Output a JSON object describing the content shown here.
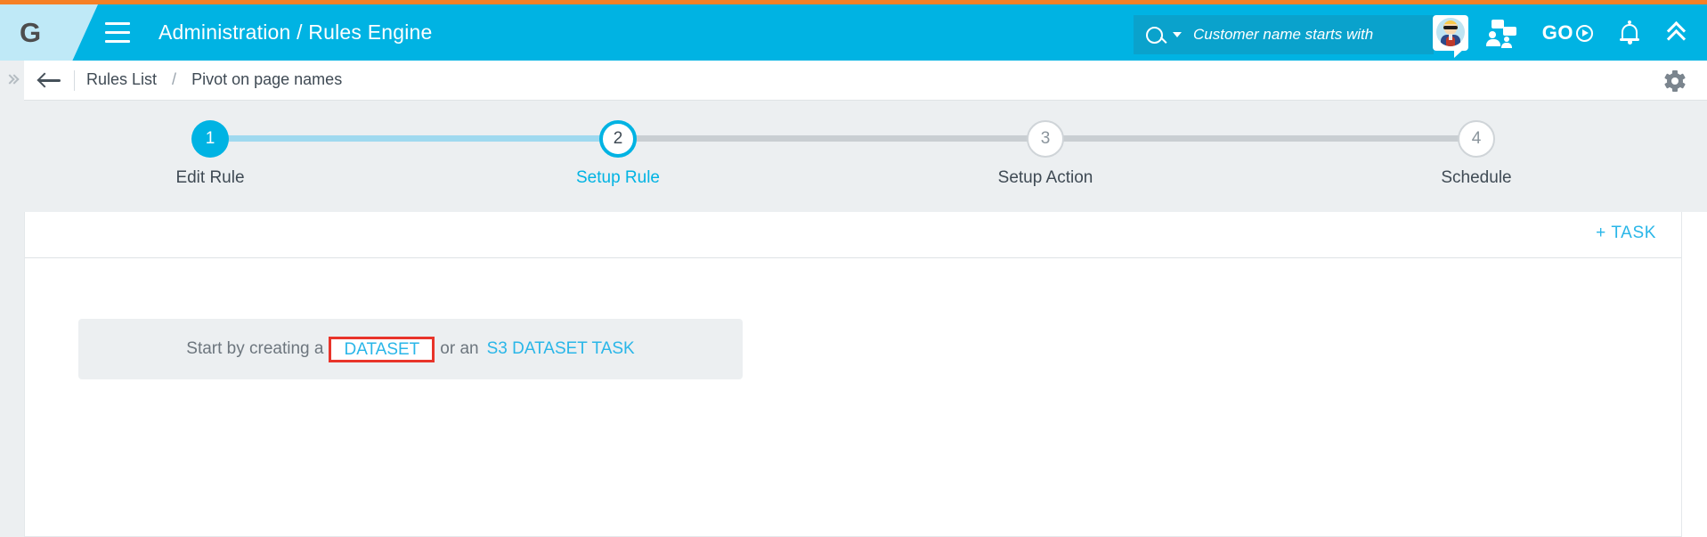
{
  "header": {
    "logo_text": "G",
    "menu_icon": "hamburger-icon",
    "title": "Administration / Rules Engine",
    "search": {
      "placeholder": "Customer name starts with",
      "value": ""
    },
    "icons": {
      "avatar": "user-avatar",
      "people_chat": "people-chat-icon",
      "go": "GO",
      "bell": "notifications-bell-icon",
      "collapse": "double-chevron-up-icon"
    }
  },
  "breadcrumb": {
    "expand_icon": "double-chevron-right-icon",
    "back_icon": "back-arrow-icon",
    "parent": "Rules List",
    "separator": "/",
    "current": "Pivot on page names",
    "settings_icon": "gear-icon"
  },
  "stepper": {
    "active_index": 2,
    "steps": [
      {
        "number": "1",
        "label": "Edit Rule",
        "state": "done"
      },
      {
        "number": "2",
        "label": "Setup Rule",
        "state": "active"
      },
      {
        "number": "3",
        "label": "Setup Action",
        "state": "todo"
      },
      {
        "number": "4",
        "label": "Schedule",
        "state": "todo"
      }
    ]
  },
  "card": {
    "toolbar": {
      "add_task_label": "+ TASK"
    },
    "empty_state": {
      "prefix": "Start by creating a",
      "dataset_link": "DATASET",
      "middle": "or an",
      "s3_link": "S3 DATASET TASK"
    }
  },
  "colors": {
    "accent_orange": "#f58025",
    "brand_cyan": "#00b3e3",
    "link_cyan": "#29b6e8",
    "band_gray": "#eceff1",
    "text_dark": "#3f4a54",
    "text_muted": "#6d767e",
    "highlight_red": "#e8342a"
  }
}
